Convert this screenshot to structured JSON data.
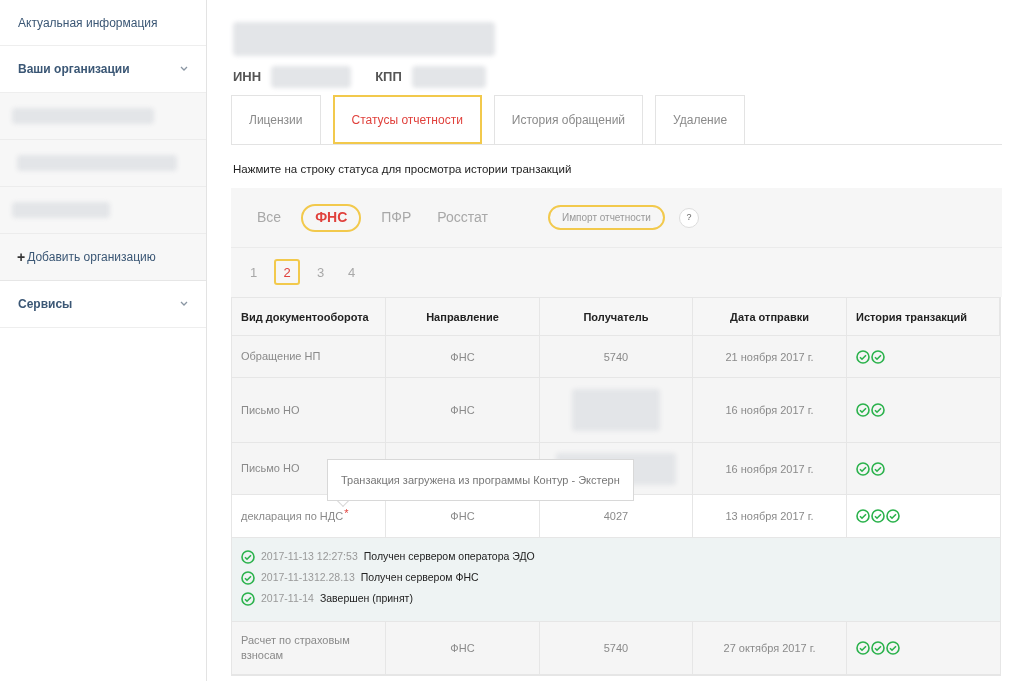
{
  "sidebar": {
    "items": [
      {
        "kind": "link",
        "label": "Актуальная информация"
      },
      {
        "kind": "section",
        "label": "Ваши организации",
        "children": [
          {
            "kind": "redacted"
          },
          {
            "kind": "redacted"
          },
          {
            "kind": "redacted"
          },
          {
            "kind": "add",
            "icon": "+",
            "label": "Добавить организацию"
          }
        ]
      },
      {
        "kind": "section",
        "label": "Сервисы"
      }
    ]
  },
  "organization": {
    "inn_label": "ИНН",
    "kpp_label": "КПП"
  },
  "tabs": [
    {
      "label": "Лицензии",
      "selected": false
    },
    {
      "label": "Статусы отчетности",
      "selected": true
    },
    {
      "label": "История обращений",
      "selected": false
    },
    {
      "label": "Удаление",
      "selected": false
    }
  ],
  "hint": "Нажмите на строку статуса для просмотра истории транзакций",
  "filters": [
    {
      "label": "Все",
      "selected": false
    },
    {
      "label": "ФНС",
      "selected": true
    },
    {
      "label": "ПФР",
      "selected": false
    },
    {
      "label": "Росстат",
      "selected": false
    }
  ],
  "import_button": "Импорт отчетности",
  "help_button": "?",
  "pages": [
    {
      "label": "1",
      "selected": false
    },
    {
      "label": "2",
      "selected": true
    },
    {
      "label": "3",
      "selected": false
    },
    {
      "label": "4",
      "selected": false
    }
  ],
  "table": {
    "columns": [
      "Вид документооборота",
      "Направление",
      "Получатель",
      "Дата отправки",
      "История транзакций"
    ],
    "rows": [
      {
        "type": "Обращение НП",
        "direction": "ФНС",
        "recipient": "5740",
        "date": "21 ноября 2017 г.",
        "checks": [
          {
            "kind": "ok"
          },
          {
            "kind": "ok"
          }
        ]
      },
      {
        "type": "Письмо НО",
        "direction": "ФНС",
        "date": "16 ноября 2017 г.",
        "checks": [
          {
            "kind": "ok"
          },
          {
            "kind": "ok"
          }
        ]
      },
      {
        "type": "Письмо НО",
        "date": "16 ноября 2017 г.",
        "checks": [
          {
            "kind": "ok"
          },
          {
            "kind": "ok"
          }
        ]
      },
      {
        "type": "декларация по НДС",
        "marker": "*",
        "direction": "ФНС",
        "recipient": "4027",
        "date": "13 ноября 2017 г.",
        "checks": [
          {
            "kind": "ok"
          },
          {
            "kind": "ok"
          },
          {
            "kind": "ok"
          }
        ],
        "history": [
          {
            "time": "2017-11-13 12:27:53",
            "status": "Получен сервером оператора ЭДО"
          },
          {
            "time": "2017-11-1312.28.13",
            "status": "Получен сервером ФНС"
          },
          {
            "time": "2017-11-14",
            "status": "Завершен (принят)"
          }
        ]
      },
      {
        "type": "Расчет по страховым взносам",
        "direction": "ФНС",
        "recipient": "5740",
        "date": "27 октября 2017 г.",
        "checks": [
          {
            "kind": "ok"
          },
          {
            "kind": "ok"
          },
          {
            "kind": "ok"
          }
        ]
      }
    ]
  },
  "tooltip": "Транзакция загружена из программы Контур - Экстерн"
}
